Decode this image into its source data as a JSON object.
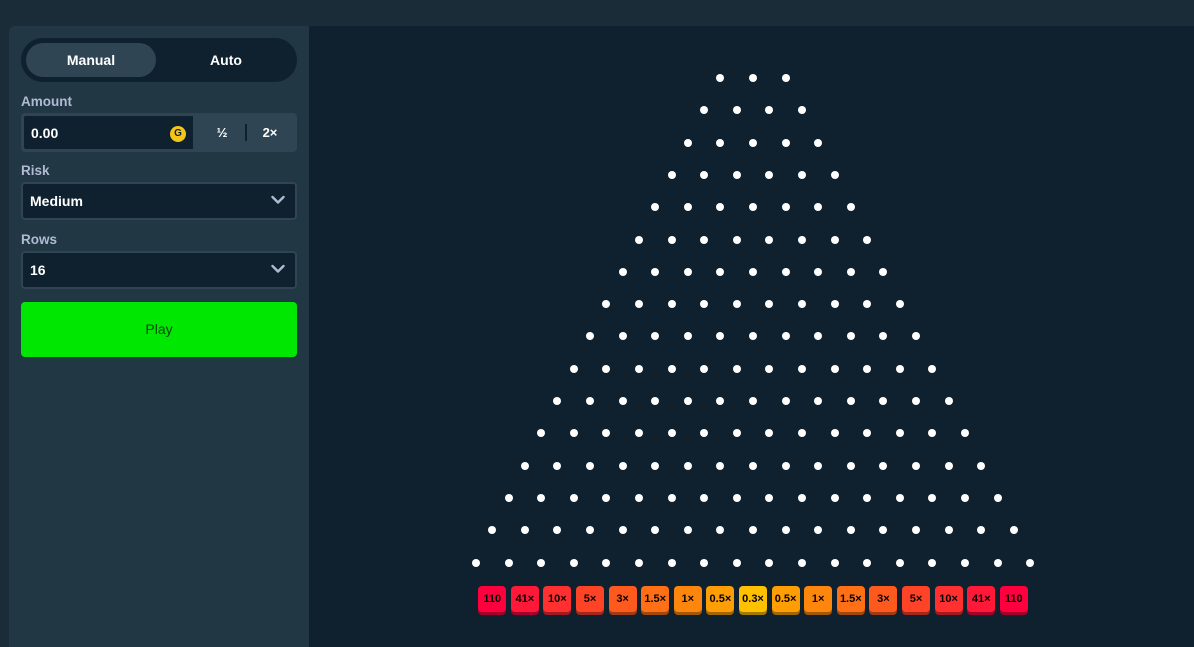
{
  "controls": {
    "mode_tabs": [
      {
        "label": "Manual",
        "active": true
      },
      {
        "label": "Auto",
        "active": false
      }
    ],
    "amount": {
      "label": "Amount",
      "value": "0.00",
      "currency_symbol": "G",
      "half_label": "½",
      "double_label": "2×"
    },
    "risk": {
      "label": "Risk",
      "selected": "Medium"
    },
    "rows": {
      "label": "Rows",
      "selected": "16"
    },
    "play_label": "Play"
  },
  "board": {
    "rows": 16,
    "multipliers": [
      {
        "label": "110",
        "color": "#ff003f",
        "shadow": "#a6002a"
      },
      {
        "label": "41×",
        "color": "#ff1837",
        "shadow": "#a5022b"
      },
      {
        "label": "10×",
        "color": "#ff302f",
        "shadow": "#a21a20"
      },
      {
        "label": "5×",
        "color": "#ff4327",
        "shadow": "#a2281b"
      },
      {
        "label": "3×",
        "color": "#ff5a1e",
        "shadow": "#a23a13"
      },
      {
        "label": "1.5×",
        "color": "#ff6f16",
        "shadow": "#a1480d"
      },
      {
        "label": "1×",
        "color": "#ff860d",
        "shadow": "#a25907"
      },
      {
        "label": "0.5×",
        "color": "#ff9d05",
        "shadow": "#a26603"
      },
      {
        "label": "0.3×",
        "color": "#ffc000",
        "shadow": "#a27a00"
      },
      {
        "label": "0.5×",
        "color": "#ff9d05",
        "shadow": "#a26603"
      },
      {
        "label": "1×",
        "color": "#ff860d",
        "shadow": "#a25907"
      },
      {
        "label": "1.5×",
        "color": "#ff6f16",
        "shadow": "#a1480d"
      },
      {
        "label": "3×",
        "color": "#ff5a1e",
        "shadow": "#a23a13"
      },
      {
        "label": "5×",
        "color": "#ff4327",
        "shadow": "#a2281b"
      },
      {
        "label": "10×",
        "color": "#ff302f",
        "shadow": "#a21a20"
      },
      {
        "label": "41×",
        "color": "#ff1837",
        "shadow": "#a5022b"
      },
      {
        "label": "110",
        "color": "#ff003f",
        "shadow": "#a6002a"
      }
    ]
  },
  "colors": {
    "background": "#1a2c38",
    "sidebar": "#213743",
    "board": "#0f212e",
    "play_button": "#00e701",
    "coin": "#f5c518"
  }
}
